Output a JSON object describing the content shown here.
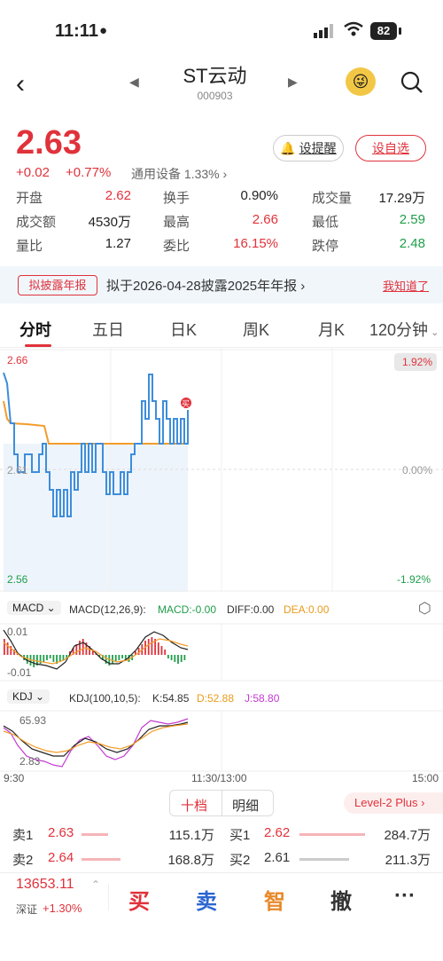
{
  "status": {
    "time": "11:11",
    "battery": "82"
  },
  "header": {
    "title": "ST云动",
    "code": "000903"
  },
  "price": {
    "last": "2.63",
    "change": "+0.02",
    "change_pct": "+0.77%",
    "sector": "通用设备 1.33%"
  },
  "buttons": {
    "alert": "设提醒",
    "watchlist": "设自选"
  },
  "quotes": [
    [
      {
        "l": "开盘",
        "v": "2.62",
        "c": "red"
      },
      {
        "l": "换手",
        "v": "0.90%",
        "c": "dark"
      },
      {
        "l": "成交量",
        "v": "17.29万",
        "c": "dark"
      }
    ],
    [
      {
        "l": "成交额",
        "v": "4530万",
        "c": "dark"
      },
      {
        "l": "最高",
        "v": "2.66",
        "c": "red"
      },
      {
        "l": "最低",
        "v": "2.59",
        "c": "green"
      }
    ],
    [
      {
        "l": "量比",
        "v": "1.27",
        "c": "dark"
      },
      {
        "l": "委比",
        "v": "16.15%",
        "c": "red"
      },
      {
        "l": "跌停",
        "v": "2.48",
        "c": "green"
      }
    ]
  ],
  "notice": {
    "tag": "拟披露年报",
    "text": "拟于2026-04-28披露2025年年报",
    "dismiss": "我知道了"
  },
  "tabs": [
    "分时",
    "五日",
    "日K",
    "周K",
    "月K",
    "120分钟"
  ],
  "chart_data": {
    "type": "line",
    "top_left": "2.66",
    "bottom_left": "2.56",
    "mid_left": "2.61",
    "top_right": "1.92%",
    "mid_right": "0.00%",
    "bottom_right": "-1.92%",
    "trade_marker": "买",
    "x_ticks": [
      "9:30",
      "11:30/13:00",
      "15:00"
    ],
    "ylim": [
      2.56,
      2.66
    ]
  },
  "macd": {
    "label": "MACD",
    "params": "MACD(12,26,9):",
    "macd": "MACD:-0.00",
    "diff": "DIFF:0.00",
    "dea": "DEA:0.00",
    "top": "0.01",
    "bottom": "-0.01"
  },
  "kdj": {
    "label": "KDJ",
    "params": "KDJ(100,10,5):",
    "k": "K:54.85",
    "d": "D:52.88",
    "j": "J:58.80",
    "top": "65.93",
    "bottom": "2.83"
  },
  "orderbook": {
    "tabs": [
      "十档",
      "明细"
    ],
    "level2": "Level-2 Plus",
    "rows": [
      {
        "side": "卖1",
        "price": "2.63",
        "vol": "115.1万",
        "bside": "买1",
        "bprice": "2.62",
        "bvol": "284.7万"
      },
      {
        "side": "卖2",
        "price": "2.64",
        "vol": "168.8万",
        "bside": "买2",
        "bprice": "2.61",
        "bvol": "211.3万"
      }
    ]
  },
  "bottom": {
    "index": "13653.11",
    "index_name": "深证",
    "index_chg": "+1.30%",
    "buy": "买",
    "sell": "卖",
    "smart": "智",
    "cancel": "撤",
    "more": "···"
  }
}
